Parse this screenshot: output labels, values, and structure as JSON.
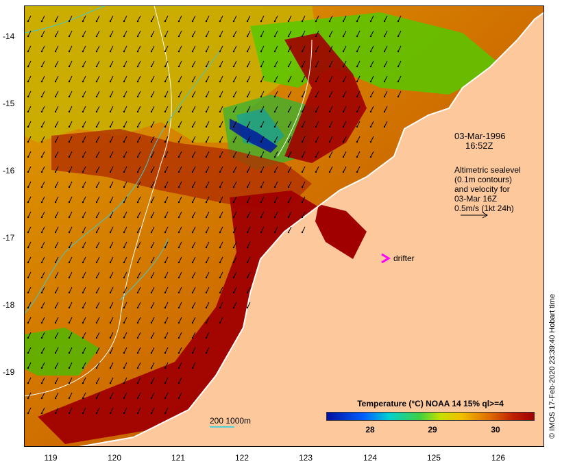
{
  "map": {
    "y_ticks": [
      "-14",
      "-15",
      "-16",
      "-17",
      "-18",
      "-19"
    ],
    "x_ticks": [
      "119",
      "120",
      "121",
      "122",
      "123",
      "124",
      "125",
      "126"
    ],
    "date_line1": "03-Mar-1996",
    "date_line2": "16:52Z",
    "desc_lines": [
      "Altimetric sealevel",
      "(0.1m contours)",
      "and velocity for",
      "03-Mar 16Z",
      "0.5m/s (1kt 24h)"
    ],
    "drifter_label": "drifter",
    "colorbar_title": "Temperature (°C) NOAA 14 15% ql>=4",
    "colorbar_ticks": [
      "28",
      "29",
      "30"
    ],
    "scale_label": "200  1000m",
    "credit": "© IMOS 17-Feb-2020 23:39:40 Hobart time",
    "colors": {
      "land": "#fcc89c",
      "warm": "#a00000",
      "orange": "#d87800",
      "yellow": "#e8d000",
      "green": "#50d000",
      "cyan": "#00d0d0",
      "blue": "#0010a0",
      "contour": "#40c8d0",
      "drifter": "#ff00ff"
    }
  }
}
